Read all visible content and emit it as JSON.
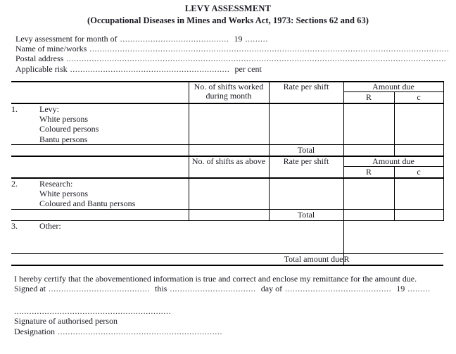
{
  "document": {
    "title": "LEVY ASSESSMENT",
    "subtitle": "(Occupational Diseases in Mines and Works Act, 1973:  Sections 62 and 63)"
  },
  "intro": {
    "line1_label": "Levy assessment for month of",
    "line1_dots": "...........................................",
    "line1_year": "19",
    "line1_year_dots": ".........",
    "line2_label": "Name of mine/works",
    "line2_dots": "................................................................................................................................................",
    "line3_label": "Postal address",
    "line3_dots": "......................................................................................................................................................",
    "line4_label": "Applicable risk",
    "line4_dots": "...............................................................",
    "line4_suffix": "per cent"
  },
  "table": {
    "headers_1": {
      "col1": "",
      "col2": "No. of shifts worked during month",
      "col3": "Rate per shift",
      "col4_group": "Amount due",
      "col4_a": "R",
      "col4_b": "c"
    },
    "headers_2": {
      "col2": "No. of shifts as above",
      "col3": "Rate per shift",
      "col4_group": "Amount due",
      "col4_a": "R",
      "col4_b": "c"
    },
    "section1": {
      "number": "1.",
      "heading": "Levy:",
      "lines": [
        "White persons",
        "Coloured persons",
        "Bantu persons"
      ],
      "total_label": "Total"
    },
    "section2": {
      "number": "2.",
      "heading": "Research:",
      "lines": [
        "White persons",
        "Coloured and Bantu persons"
      ],
      "total_label": "Total"
    },
    "section3": {
      "number": "3.",
      "heading": "Other:"
    },
    "grand_total": {
      "label": "Total amount due",
      "currency": "R"
    }
  },
  "footer": {
    "certify": "I hereby certify that the abovementioned information is true and correct and enclose my remittance for the amount due.",
    "signed_at_label": "Signed at",
    "signed_at_dots": "........................................",
    "this_label": "this",
    "this_dots": "..................................",
    "day_of_label": "day of",
    "day_of_dots": "..........................................",
    "year": "19",
    "year_dots": ".........",
    "signature_rule": "..............................................................",
    "signature_caption": "Signature of authorised person",
    "designation_label": "Designation",
    "designation_dots": "................................................................."
  },
  "colors": {
    "ink": "#1a1a22",
    "rule": "#000000",
    "paper": "#ffffff"
  }
}
